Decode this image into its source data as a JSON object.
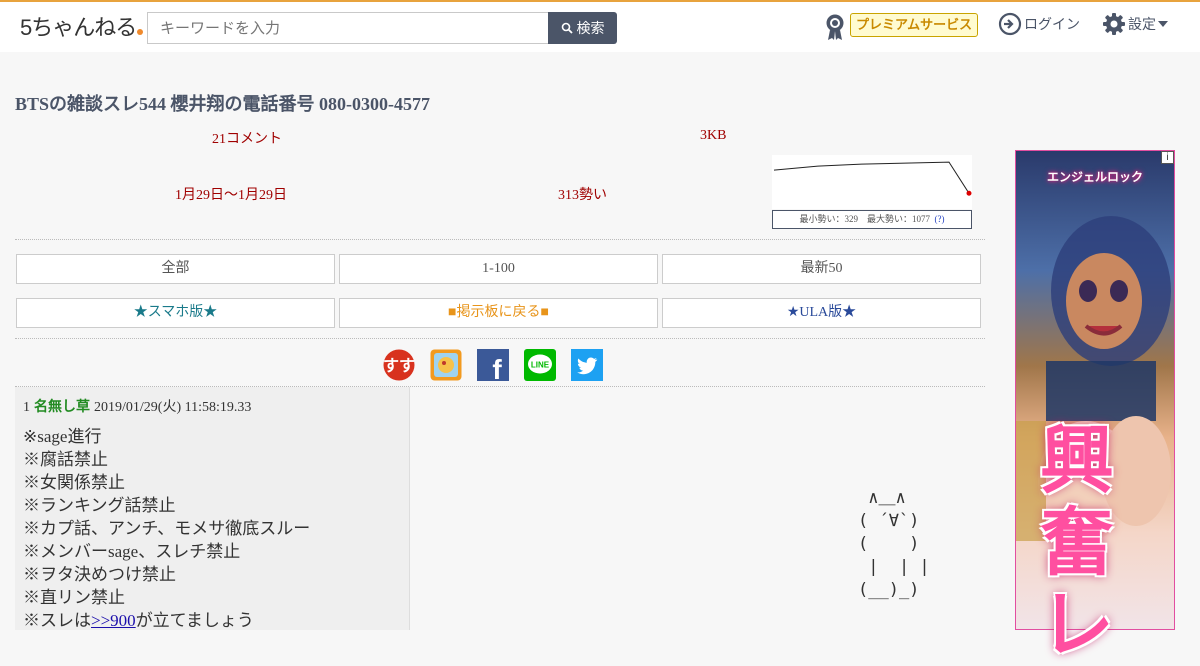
{
  "header": {
    "logo_text": "5ちゃんねる",
    "search_placeholder": "キーワードを入力",
    "search_button": "検索",
    "premium_label": "プレミアムサービス",
    "login_label": "ログイン",
    "settings_label": "設定"
  },
  "thread": {
    "title": "BTSの雑談スレ544 櫻井翔の電話番号 080-0300-4577",
    "comments": "21コメント",
    "size": "3KB",
    "dates": "1月29日〜1月29日",
    "momentum": "313勢い",
    "graph_caption_min": "最小勢い：329",
    "graph_caption_max": "最大勢い：1077",
    "graph_caption_help": "(?)"
  },
  "nav": {
    "all": "全部",
    "range": "1-100",
    "latest": "最新50",
    "smartphone": "★スマホ版★",
    "back_to_board": "■掲示板に戻る■",
    "ula": "★ULA版★"
  },
  "share": {
    "icons": [
      "matome-icon",
      "bookmark-icon",
      "facebook-icon",
      "line-icon",
      "twitter-icon"
    ],
    "line_label": "LINE",
    "facebook_label": "f"
  },
  "post": {
    "number": "1",
    "name": "名無し草",
    "datetime": "2019/01/29(火) 11:58:19.33",
    "lines": [
      "※sage進行",
      "※腐話禁止",
      "※女関係禁止",
      "※ランキング話禁止",
      "※カプ話、アンチ、モメサ徹底スルー",
      "※メンバーsage、スレチ禁止",
      "※ヲタ決めつけ禁止",
      "※直リン禁止"
    ],
    "last_line_prefix": "※スレは",
    "last_line_link": ">>900",
    "last_line_suffix": "が立てましょう",
    "ascii_art": " ∧＿∧\n( ´∀`)\n(    )\n |  | |\n(__)_)"
  },
  "ad": {
    "brand": "エンジェルロック",
    "headline": "興\n奮\nレ",
    "info": "i"
  },
  "colors": {
    "accent": "#4b5568",
    "comment_red": "#a00000",
    "name_green": "#228b22",
    "link_teal": "#1a7a8a",
    "link_orange": "#e8941a",
    "link_blue": "#2a4a9a"
  },
  "chart_data": {
    "type": "line",
    "values": [
      1077,
      1077,
      1077,
      1077,
      1077,
      329
    ]
  }
}
